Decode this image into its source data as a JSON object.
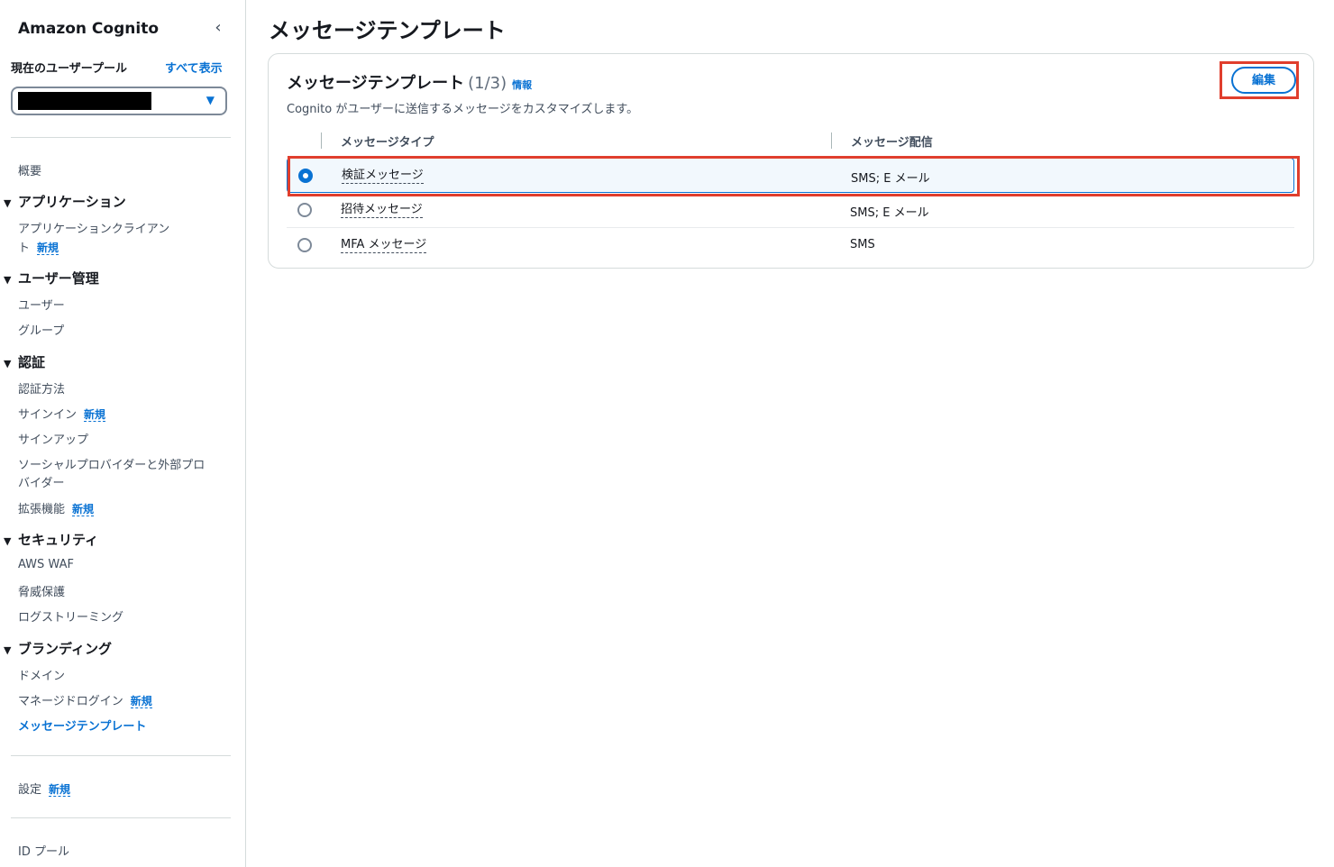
{
  "sidebar": {
    "title": "Amazon Cognito",
    "collapse_icon": "chevron-left-icon",
    "pool_label": "現在のユーザープール",
    "show_all": "すべて表示",
    "new_badge": "新規",
    "overview": "概要",
    "sections": [
      {
        "heading": "アプリケーション",
        "items": [
          {
            "label_line1": "アプリケーションクライアン",
            "label_line2": "ト",
            "new": true
          }
        ]
      },
      {
        "heading": "ユーザー管理",
        "items": [
          {
            "label": "ユーザー"
          },
          {
            "label": "グループ"
          }
        ]
      },
      {
        "heading": "認証",
        "items": [
          {
            "label": "認証方法"
          },
          {
            "label": "サインイン",
            "new": true
          },
          {
            "label": "サインアップ"
          },
          {
            "label_line1": "ソーシャルプロバイダーと外部プロ",
            "label_line2": "バイダー"
          },
          {
            "label": "拡張機能",
            "new": true
          }
        ]
      },
      {
        "heading": "セキュリティ",
        "items": [
          {
            "label": "AWS WAF"
          },
          {
            "label": "脅威保護"
          },
          {
            "label": "ログストリーミング"
          }
        ]
      },
      {
        "heading": "ブランディング",
        "items": [
          {
            "label": "ドメイン"
          },
          {
            "label": "マネージドログイン",
            "new": true
          },
          {
            "label": "メッセージテンプレート",
            "active": true
          }
        ]
      }
    ],
    "settings": "設定",
    "id_pool": "ID プール"
  },
  "main": {
    "page_title": "メッセージテンプレート",
    "panel": {
      "title": "メッセージテンプレート",
      "count": "(1/3)",
      "info": "情報",
      "description": "Cognito がユーザーに送信するメッセージをカスタマイズします。",
      "edit_button": "編集",
      "columns": [
        "メッセージタイプ",
        "メッセージ配信"
      ],
      "rows": [
        {
          "type": "検証メッセージ",
          "delivery": "SMS; E メール",
          "selected": true
        },
        {
          "type": "招待メッセージ",
          "delivery": "SMS; E メール",
          "selected": false
        },
        {
          "type": "MFA メッセージ",
          "delivery": "SMS",
          "selected": false
        }
      ]
    }
  },
  "colors": {
    "accent": "#0972d3",
    "highlight": "#e03e2d"
  }
}
